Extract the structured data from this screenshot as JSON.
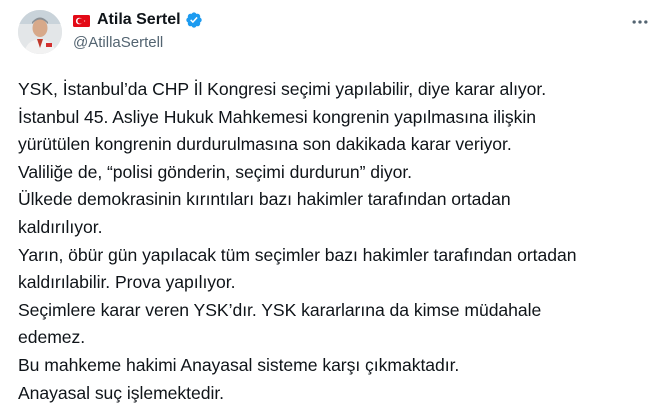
{
  "author": {
    "display_name": "Atila Sertel",
    "handle": "@AtillaSertell",
    "flag_icon": "turkey-flag-icon",
    "verified_icon": "verified-badge-icon",
    "verified_color": "#1d9bf0"
  },
  "menu": {
    "icon": "more-horizontal-icon"
  },
  "tweet": {
    "lines": [
      "YSK, İstanbul’da CHP İl Kongresi seçimi yapılabilir, diye karar alıyor.",
      "İstanbul 45. Asliye Hukuk Mahkemesi kongrenin yapılmasına ilişkin",
      "yürütülen kongrenin durdurulmasına son dakikada karar veriyor.",
      "Valiliğe de, “polisi gönderin, seçimi durdurun” diyor.",
      "Ülkede demokrasinin kırıntıları bazı hakimler tarafından ortadan",
      "kaldırılıyor.",
      "Yarın, öbür gün yapılacak tüm seçimler bazı hakimler tarafından ortadan",
      "kaldırılabilir. Prova yapılıyor.",
      "Seçimlere karar veren YSK’dır. YSK kararlarına da kimse müdahale",
      "edemez.",
      "Bu mahkeme hakimi Anayasal sisteme karşı çıkmaktadır.",
      "Anayasal suç işlemektedir."
    ]
  }
}
